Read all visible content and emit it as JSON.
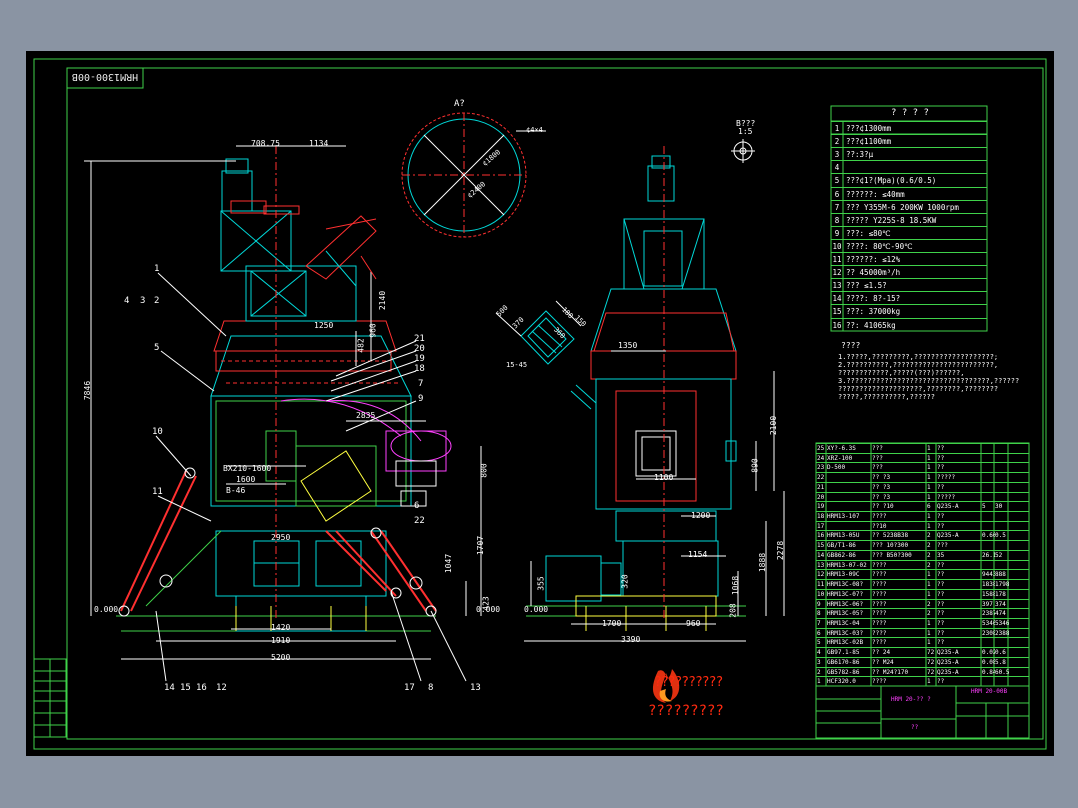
{
  "drawing_code": "HRM1300-00B",
  "section_label": "A?",
  "detail_label": "B???",
  "detail_scale": "1:5",
  "spec_title": "? ? ? ?",
  "spec_rows": [
    {
      "n": "1",
      "t": "???¢1300mm"
    },
    {
      "n": "2",
      "t": "???¢1100mm"
    },
    {
      "n": "3",
      "t": "??:3?µ"
    },
    {
      "n": "4",
      "t": ""
    },
    {
      "n": "5",
      "t": "???¢1?(Mpa)(0.6/0.5)"
    },
    {
      "n": "6",
      "t": "??????: ≤40mm"
    },
    {
      "n": "7",
      "t": "??? Y355M-6 200KW 1000rpm"
    },
    {
      "n": "8",
      "t": "?????  Y225S-8 18.5KW"
    },
    {
      "n": "9",
      "t": "???: ≤80℃"
    },
    {
      "n": "10",
      "t": "????: 80℃-90℃"
    },
    {
      "n": "11",
      "t": "??????: ≤12%"
    },
    {
      "n": "12",
      "t": "?? 45000m³/h"
    },
    {
      "n": "13",
      "t": "??? ≤1.5?"
    },
    {
      "n": "14",
      "t": "????: 8?-15?"
    },
    {
      "n": "15",
      "t": "???: 37000kg"
    },
    {
      "n": "16",
      "t": "??: 41065kg"
    }
  ],
  "notes_title": "????",
  "notes_lines": [
    "1.?????,?????????,???????????????????;",
    "2.??????????,????????????????????????,",
    "  ????????????,?????(???)??????,",
    "3.??????????????????????????????????,??????",
    "  ????????????????????,????????,????????",
    "  ?????,??????????,??????"
  ],
  "bom": [
    {
      "no": "25",
      "code": "XY?-6.3S",
      "name": "???",
      "q": "1",
      "mat": "??",
      "c5": "",
      "c6": ""
    },
    {
      "no": "24",
      "code": "XRZ-100",
      "name": "???",
      "q": "1",
      "mat": "??",
      "c5": "",
      "c6": ""
    },
    {
      "no": "23",
      "code": "D-500",
      "name": "???",
      "q": "1",
      "mat": "??",
      "c5": "",
      "c6": ""
    },
    {
      "no": "22",
      "code": "",
      "name": "?? ?3",
      "q": "1",
      "mat": "?????",
      "c5": "",
      "c6": ""
    },
    {
      "no": "21",
      "code": "",
      "name": "?? ?3",
      "q": "1",
      "mat": "??",
      "c5": "",
      "c6": ""
    },
    {
      "no": "20",
      "code": "",
      "name": "?? ?3",
      "q": "1",
      "mat": "?????",
      "c5": "",
      "c6": ""
    },
    {
      "no": "19",
      "code": "",
      "name": "?? ?10",
      "q": "6",
      "mat": "Q235-A",
      "c5": "5",
      "c6": "30"
    },
    {
      "no": "18",
      "code": "HRM13-107",
      "name": "????",
      "q": "1",
      "mat": "??",
      "c5": "",
      "c6": ""
    },
    {
      "no": "17",
      "code": "",
      "name": "??10",
      "q": "1",
      "mat": "??",
      "c5": "",
      "c6": ""
    },
    {
      "no": "16",
      "code": "HRM13-05U",
      "name": "?? 5238B38",
      "q": "2",
      "mat": "Q235-A",
      "c5": "0.66",
      "c6": "0.5"
    },
    {
      "no": "15",
      "code": "GB/T1-86",
      "name": "??? 10?300",
      "q": "2",
      "mat": "???",
      "c5": "",
      "c6": ""
    },
    {
      "no": "14",
      "code": "GB862-86",
      "name": "??? B50?300",
      "q": "2",
      "mat": "35",
      "c5": "26.1",
      "c6": "52"
    },
    {
      "no": "13",
      "code": "HRM13-07-02",
      "name": "????",
      "q": "2",
      "mat": "??",
      "c5": "",
      "c6": ""
    },
    {
      "no": "12",
      "code": "HRM13-09C",
      "name": "????",
      "q": "1",
      "mat": "??",
      "c5": "9443",
      "c6": "888"
    },
    {
      "no": "11",
      "code": "HRM13C-08?",
      "name": "????",
      "q": "1",
      "mat": "??",
      "c5": "1838",
      "c6": "1798"
    },
    {
      "no": "10",
      "code": "HRM13C-07?",
      "name": "????",
      "q": "1",
      "mat": "??",
      "c5": "1588",
      "c6": "178"
    },
    {
      "no": "9",
      "code": "HRM13C-06?",
      "name": "????",
      "q": "2",
      "mat": "??",
      "c5": "397",
      "c6": "374"
    },
    {
      "no": "8",
      "code": "HRM13C-05?",
      "name": "????",
      "q": "2",
      "mat": "??",
      "c5": "2387",
      "c6": "474"
    },
    {
      "no": "7",
      "code": "HRM13C-04",
      "name": "????",
      "q": "1",
      "mat": "??",
      "c5": "5346",
      "c6": "5346"
    },
    {
      "no": "6",
      "code": "HRM13C-03?",
      "name": "????",
      "q": "1",
      "mat": "??",
      "c5": "2308",
      "c6": "2388"
    },
    {
      "no": "5",
      "code": "HRM13C-02B",
      "name": "????",
      "q": "1",
      "mat": "??",
      "c5": "",
      "c6": ""
    },
    {
      "no": "4",
      "code": "GB97.1-85",
      "name": "?? 24",
      "q": "72",
      "mat": "Q235-A",
      "c5": "0.02",
      "c6": "0.6"
    },
    {
      "no": "3",
      "code": "GB6170-86",
      "name": "?? M24",
      "q": "72",
      "mat": "Q235-A",
      "c5": "0.08",
      "c6": "5.8"
    },
    {
      "no": "2",
      "code": "GB5782-86",
      "name": "?? M24?170",
      "q": "72",
      "mat": "Q235-A",
      "c5": "0.84",
      "c6": "60.5"
    },
    {
      "no": "1",
      "code": "HCF320.0",
      "name": "????",
      "q": "1",
      "mat": "??",
      "c5": "",
      "c6": ""
    }
  ],
  "title_block": {
    "product": "HRM 20-00B",
    "drawing_name": "HRM 20-?? ?",
    "sheet": "??"
  },
  "watermark_text": "??????????",
  "watermark_subtext": "?????????",
  "dims": {
    "top_w1": "708.75",
    "top_w2": "1134",
    "h_total": "7846",
    "h_upper": "2140",
    "v960": "960",
    "v482": "482",
    "v1250": "1250",
    "w2835": "2835",
    "w1600": "1600",
    "w2950": "2950",
    "w1420": "1420",
    "w1910": "1910",
    "w5200": "5200",
    "v1707": "1707",
    "v1047": "1047",
    "v800": "800",
    "v423": "423",
    "w1350": "1350",
    "w1100": "1100",
    "w1200": "1200",
    "w1154": "1154",
    "w1700": "1700",
    "w960": "960",
    "w3390": "3390",
    "v2100": "2100",
    "v890": "890",
    "v2278": "2278",
    "v1888": "1888",
    "v1068": "1068",
    "v355": "355",
    "v320": "320",
    "v208": "208",
    "dia_a": "¢4×4",
    "d_360": "360",
    "d_370": "370",
    "d_500": "500",
    "d_180": "180",
    "level0": "0.000",
    "sq_500": "500",
    "sq_370": "370",
    "sq_360": "360",
    "sq_180": "180",
    "sq_150": "150",
    "sq_160": "160",
    "elev_1": "15-45",
    "bm_label": "BX210-1600",
    "b_label": "B-46",
    "a_ring": "¢1800",
    "a_ring2": "¢2400"
  },
  "part_numbers": [
    "1",
    "2",
    "3",
    "4",
    "5",
    "10",
    "11",
    "14",
    "15",
    "16",
    "12",
    "17",
    "8",
    "13",
    "20",
    "21",
    "19",
    "18",
    "7",
    "9",
    "22",
    "6"
  ],
  "revision_rows": [
    "",
    "",
    "",
    "",
    "",
    "",
    "",
    "",
    ""
  ],
  "bottom_left_labels": [
    "?",
    "??",
    "?",
    "??"
  ],
  "title_small": [
    "???",
    "???",
    "??",
    "???",
    "??",
    "??"
  ]
}
